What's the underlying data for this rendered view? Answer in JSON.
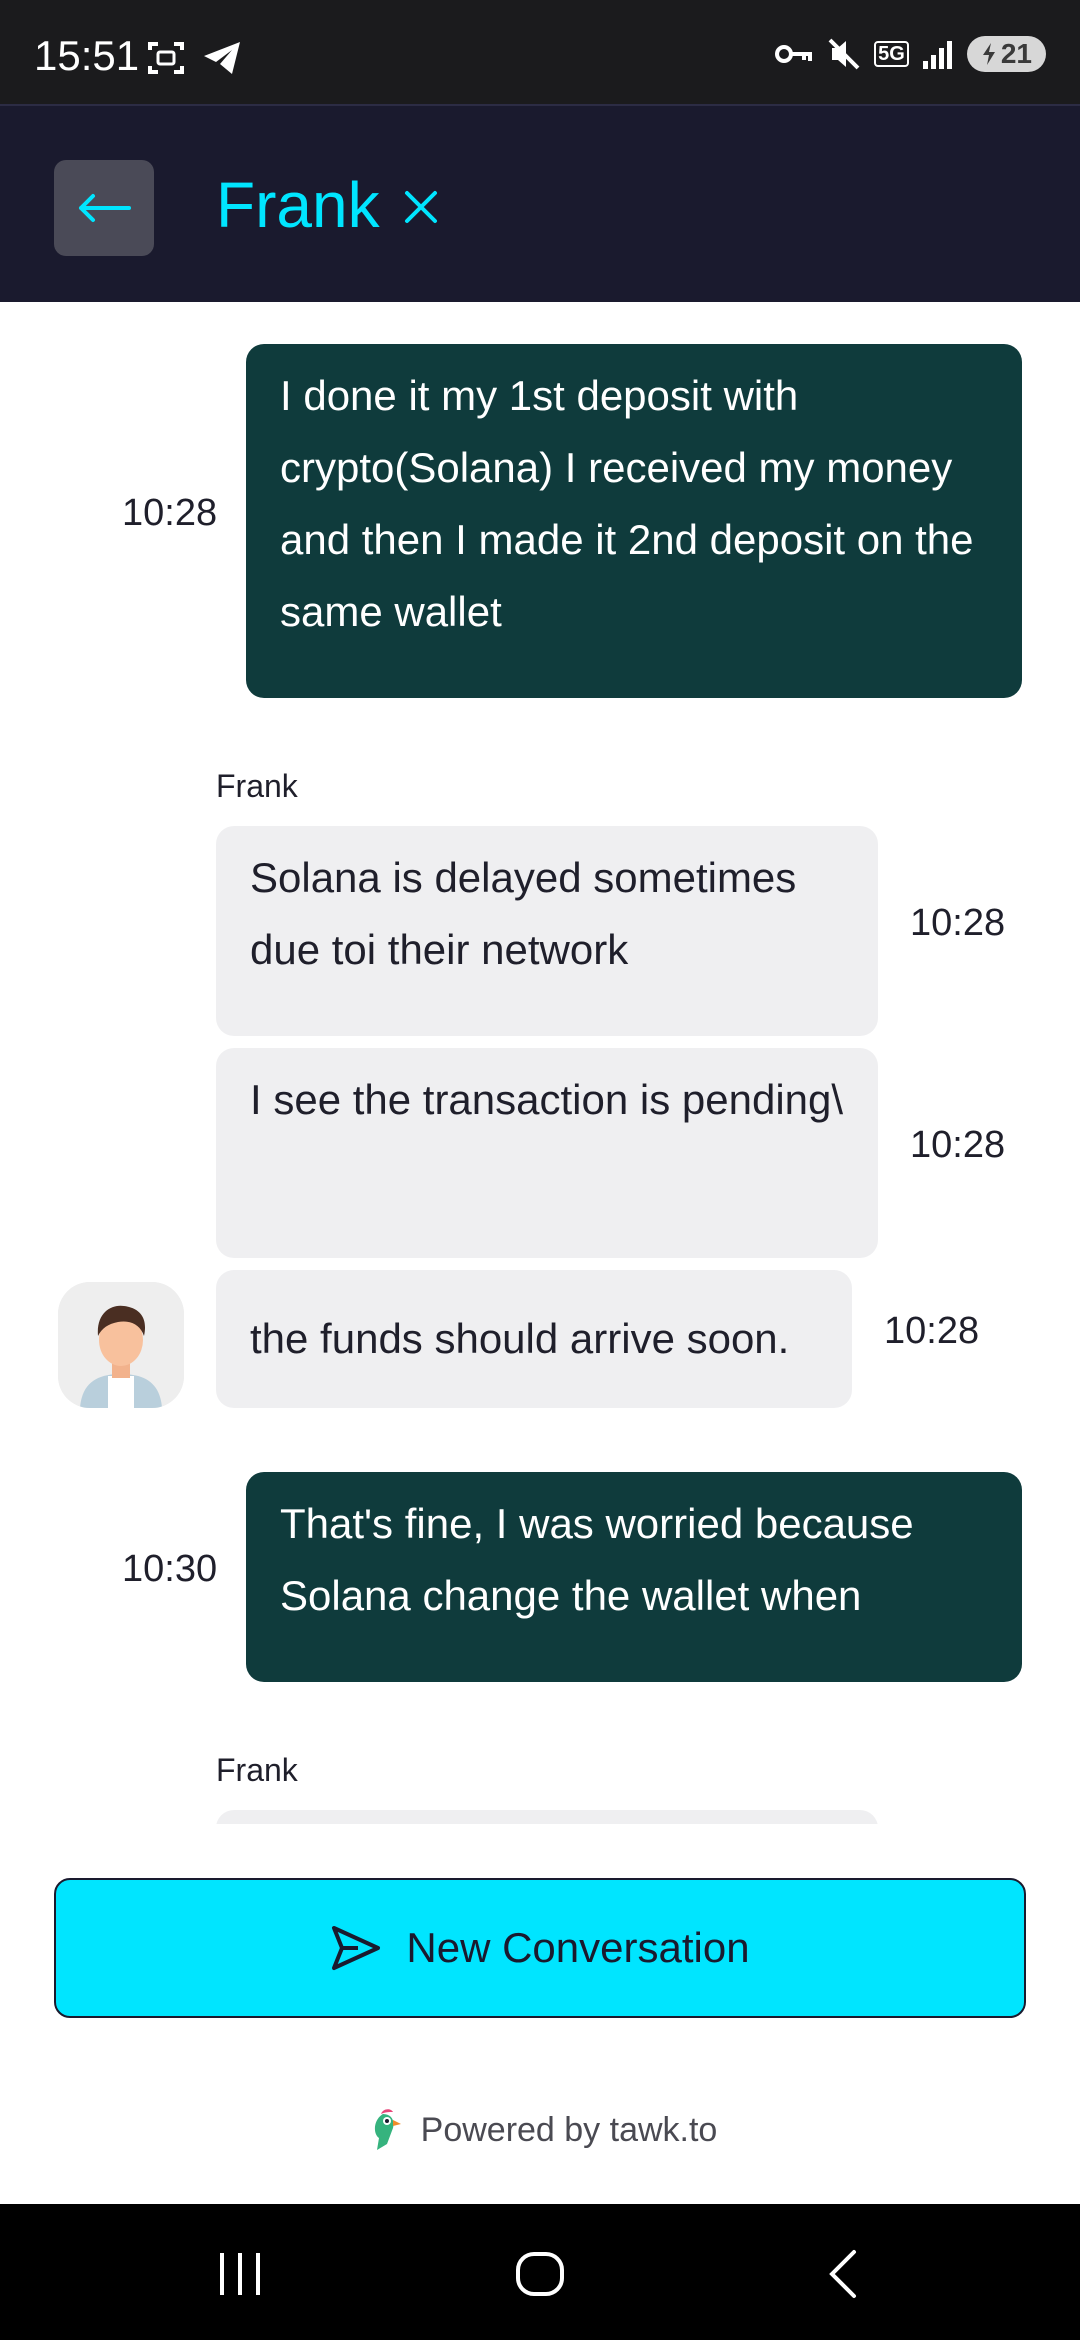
{
  "status_bar": {
    "time": "15:51",
    "battery": "21",
    "network": "5G"
  },
  "header": {
    "title": "Frank",
    "back_icon": "arrow-left-icon",
    "close_icon": "close-icon"
  },
  "messages": [
    {
      "direction": "out",
      "time": "10:28",
      "text": "I done it my 1st deposit with crypto(Solana) I received my money and then I made it 2nd deposit on the same wallet"
    },
    {
      "direction": "in",
      "sender": "Frank",
      "time": "10:28",
      "text": "Solana is delayed sometimes due toi their network"
    },
    {
      "direction": "in",
      "time": "10:28",
      "text": "I see the transaction is pending\\"
    },
    {
      "direction": "in",
      "time": "10:28",
      "text": "the funds should arrive soon."
    },
    {
      "direction": "out",
      "time": "10:30",
      "text": "That's fine, I was worried because Solana change the wallet when"
    },
    {
      "direction": "in",
      "sender": "Frank"
    }
  ],
  "new_conversation": {
    "label": "New Conversation",
    "icon": "send-icon"
  },
  "footer": {
    "powered_by": "Powered by tawk.to"
  },
  "colors": {
    "accent": "#00e5ff",
    "header_bg": "#1a1a2e",
    "outgoing_bubble": "#0f3b3c",
    "incoming_bubble": "#efeff1"
  }
}
